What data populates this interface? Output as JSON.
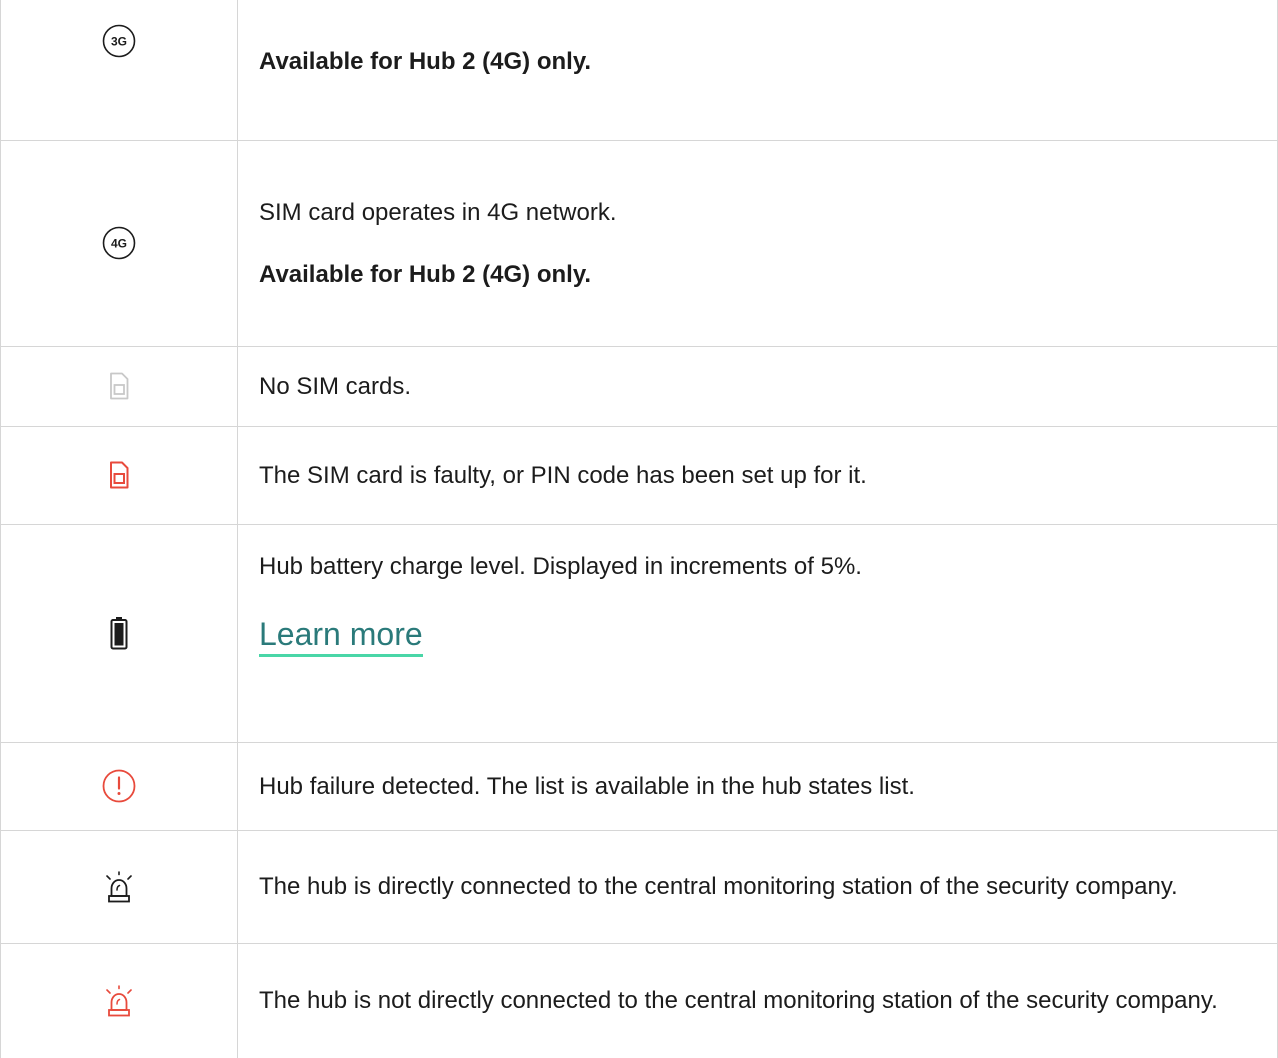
{
  "rows": [
    {
      "icon": "3g-icon",
      "icon_text": "3G",
      "lines": [],
      "bold": "Available for Hub 2 (4G) only."
    },
    {
      "icon": "4g-icon",
      "icon_text": "4G",
      "lines": [
        "SIM card operates in 4G network."
      ],
      "bold": "Available for Hub 2 (4G) only."
    },
    {
      "icon": "sim-card-gray-icon",
      "text": "No SIM cards."
    },
    {
      "icon": "sim-card-red-icon",
      "text": "The SIM card is faulty, or PIN code has been set up for it."
    },
    {
      "icon": "battery-icon",
      "text": "Hub battery charge level. Displayed in increments of 5%.",
      "link": "Learn more"
    },
    {
      "icon": "alert-icon",
      "text": "Hub failure detected. The list is available in the hub states list."
    },
    {
      "icon": "siren-icon",
      "text": "The hub is directly connected to the central monitoring station of the security company."
    },
    {
      "icon": "siren-red-icon",
      "text": "The hub is not directly connected to the central monitoring station of the security company."
    }
  ],
  "colors": {
    "red": "#e84a3c",
    "gray": "#c8c8c8",
    "dark": "#1c1c1c",
    "link_underline": "#49d6a7"
  }
}
